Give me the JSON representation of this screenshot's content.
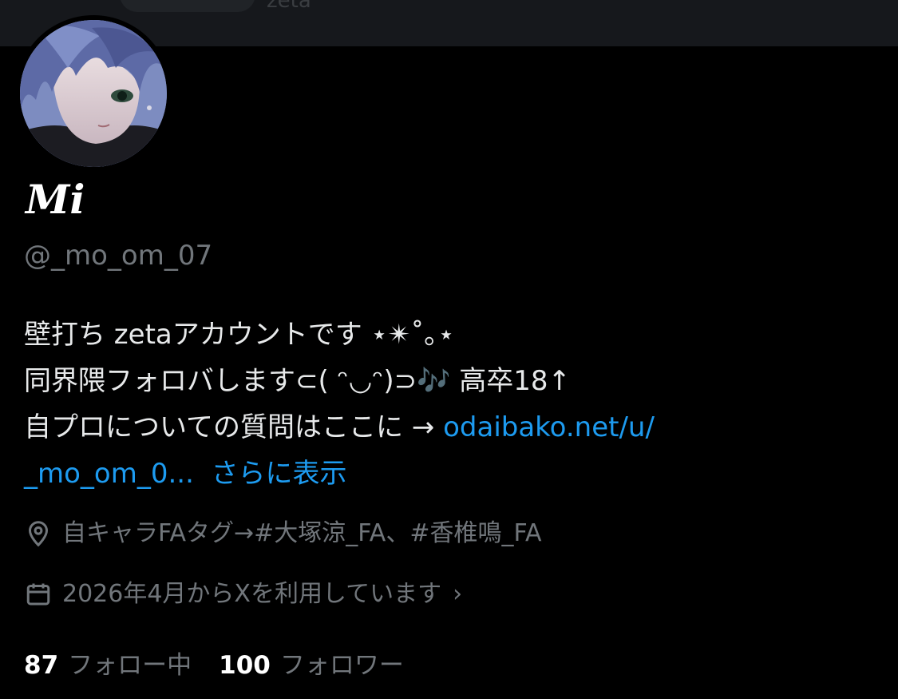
{
  "header": {
    "search_text": "zeta"
  },
  "profile": {
    "display_name": "Mi",
    "handle": "@_mo_om_07",
    "bio": {
      "line1": "壁打ち zetaアカウントです ⋆✴︎˚｡⋆",
      "line2": "同界隈フォロバします⊂( ᵔ◡ᵔ)⊃🎶 高卒18↑",
      "line3_text": "自プロについての質問はここに → ",
      "line3_link": "odaibako.net/u/",
      "line4_link": "_mo_om_0...",
      "show_more": "さらに表示"
    },
    "location": "自キャラFAタグ→#大塚涼_FA、#香椎鳴_FA",
    "joined": "2026年4月からXを利用しています",
    "following_count": "87",
    "following_label": "フォロー中",
    "followers_count": "100",
    "followers_label": "フォロワー"
  },
  "icons": {
    "location": "location-pin-icon",
    "calendar": "calendar-icon",
    "chevron": "chevron-right-icon"
  },
  "colors": {
    "background": "#000000",
    "link": "#1d9bf0",
    "secondary_text": "#71767b",
    "primary_text": "#e7e9ea"
  }
}
